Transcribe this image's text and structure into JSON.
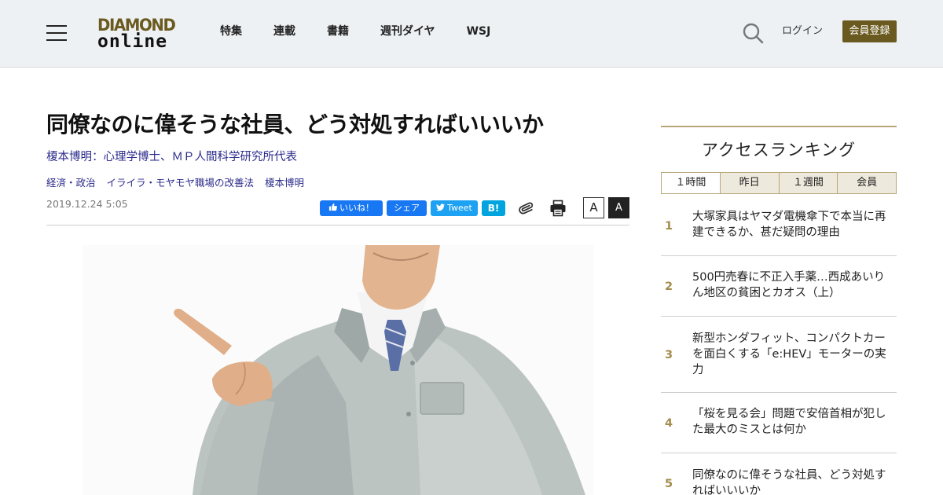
{
  "header": {
    "logo_top": "DIAMOND",
    "logo_bottom": "online",
    "nav": [
      "特集",
      "連載",
      "書籍",
      "週刊ダイヤ",
      "WSJ"
    ],
    "login": "ログイン",
    "register": "会員登録"
  },
  "article": {
    "title": "同僚なのに偉そうな社員、どう対処すればいいいか",
    "author_line": "榎本博明：心理学博士、ＭＰ人間科学研究所代表",
    "tags": [
      "経済・政治",
      "イライラ・モヤモヤ職場の改善法",
      "榎本博明"
    ],
    "date": "2019.12.24 5:05",
    "share": {
      "like": "いいね！",
      "share": "シェア",
      "tweet": "Tweet",
      "hatena": "B!"
    },
    "font_small": "A",
    "font_large": "A"
  },
  "sidebar": {
    "ranking_title": "アクセスランキング",
    "tabs": [
      "１時間",
      "昨日",
      "１週間",
      "会員"
    ],
    "active_tab": "１時間",
    "items": [
      {
        "rank": "1",
        "text": "大塚家具はヤマダ電機傘下で本当に再建できるか、甚だ疑問の理由"
      },
      {
        "rank": "2",
        "text": "500円売春に不正入手薬…西成あいりん地区の貧困とカオス（上）"
      },
      {
        "rank": "3",
        "text": "新型ホンダフィット、コンパクトカーを面白くする「e:HEV」モーターの実力"
      },
      {
        "rank": "4",
        "text": "「桜を見る会」問題で安倍首相が犯した最大のミスとは何か"
      },
      {
        "rank": "5",
        "text": "同僚なのに偉そうな社員、どう対処すればいいいか"
      }
    ]
  },
  "colors": {
    "brand_gold": "#6b5a1f",
    "rank_accent": "#a48c4c",
    "link_blue": "#2b2b8c",
    "facebook": "#1877f2",
    "twitter": "#1da1f2",
    "hatena": "#00a4de"
  }
}
